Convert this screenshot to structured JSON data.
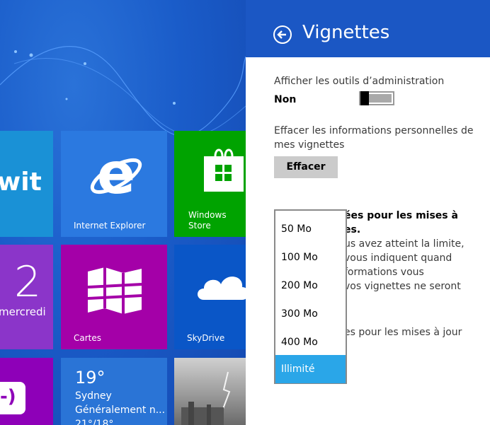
{
  "start_tiles": {
    "twitter": {
      "label": "wit",
      "color": "#1a91d6"
    },
    "internet_explorer": {
      "label": "Internet Explorer",
      "color": "#2b79e0"
    },
    "store": {
      "label": "Windows\nStore",
      "color": "#00a300"
    },
    "calendar": {
      "day": "2",
      "weekday": "mercredi",
      "color": "#8b35c9"
    },
    "maps": {
      "label": "Cartes",
      "color": "#a400a8"
    },
    "skydrive": {
      "label": "SkyDrive",
      "color": "#0a56c7"
    },
    "messaging": {
      "color": "#8e00b8"
    },
    "weather": {
      "temp": "19°",
      "city": "Sydney",
      "cond": "Généralement n...",
      "range": "21°/18°",
      "color": "#2a74d6"
    }
  },
  "panel": {
    "title": "Vignettes",
    "admin_tools_label": "Afficher les outils d’administration",
    "admin_tools_value": "Non",
    "clear_label_1": "Effacer les informations personnelles de",
    "clear_label_2": "mes vignettes",
    "clear_button": "Effacer",
    "obscured_lines": [
      "ées pour les mises à",
      "es.",
      "us avez atteint la limite,",
      " vous indiquent quand",
      "formations vous",
      "vos vignettes ne seront",
      ".",
      "es pour les mises à jour"
    ]
  },
  "dropdown": {
    "options": [
      "50 Mo",
      "100 Mo",
      "200 Mo",
      "300 Mo",
      "400 Mo",
      "Illimité"
    ],
    "selected": "Illimité",
    "selected_color": "#2aa6e8"
  },
  "colors": {
    "panel_header": "#1b57c4",
    "start_bg": "#1a5cc9"
  }
}
